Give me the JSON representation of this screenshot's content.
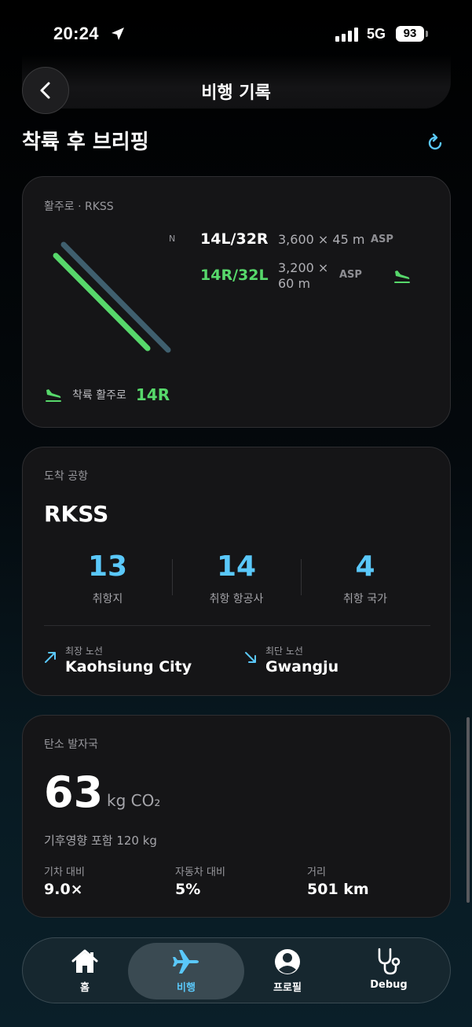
{
  "status_bar": {
    "time": "20:24",
    "network": "5G",
    "battery": "93"
  },
  "header": {
    "title": "비행 기록"
  },
  "section": {
    "title": "착륙 후 브리핑"
  },
  "runway_card": {
    "label": "활주로 · RKSS",
    "north": "N",
    "runways": [
      {
        "name": "14L/32R",
        "dim_line1": "3,600 × 45 m",
        "dim_line2": "",
        "surface": "ASP",
        "color": "#ffffff"
      },
      {
        "name": "14R/32L",
        "dim_line1": "3,200 ×",
        "dim_line2": "60 m",
        "surface": "ASP",
        "color": "#57d86b"
      }
    ],
    "landing_label": "착륙 활주로",
    "landing_value": "14R"
  },
  "airport_card": {
    "label": "도착 공항",
    "code": "RKSS",
    "stats": [
      {
        "value": "13",
        "label": "취항지"
      },
      {
        "value": "14",
        "label": "취항 항공사"
      },
      {
        "value": "4",
        "label": "취항 국가"
      }
    ],
    "longest": {
      "label": "최장 노선",
      "value": "Kaohsiung City"
    },
    "shortest": {
      "label": "최단 노선",
      "value": "Gwangju"
    }
  },
  "carbon_card": {
    "label": "탄소 발자국",
    "value": "63",
    "unit": "kg CO₂",
    "sub": "기후영향 포함 120 kg",
    "comparisons": [
      {
        "label": "기차 대비",
        "value": "9.0×"
      },
      {
        "label": "자동차 대비",
        "value": "5%"
      },
      {
        "label": "거리",
        "value": "501 km"
      }
    ]
  },
  "tab_bar": {
    "items": [
      {
        "label": "홈",
        "icon": "home-icon"
      },
      {
        "label": "비행",
        "icon": "airplane-icon"
      },
      {
        "label": "프로필",
        "icon": "profile-icon"
      },
      {
        "label": "Debug",
        "icon": "stethoscope-icon"
      }
    ]
  },
  "colors": {
    "accent_blue": "#5ac8fa",
    "accent_green": "#57d86b"
  }
}
